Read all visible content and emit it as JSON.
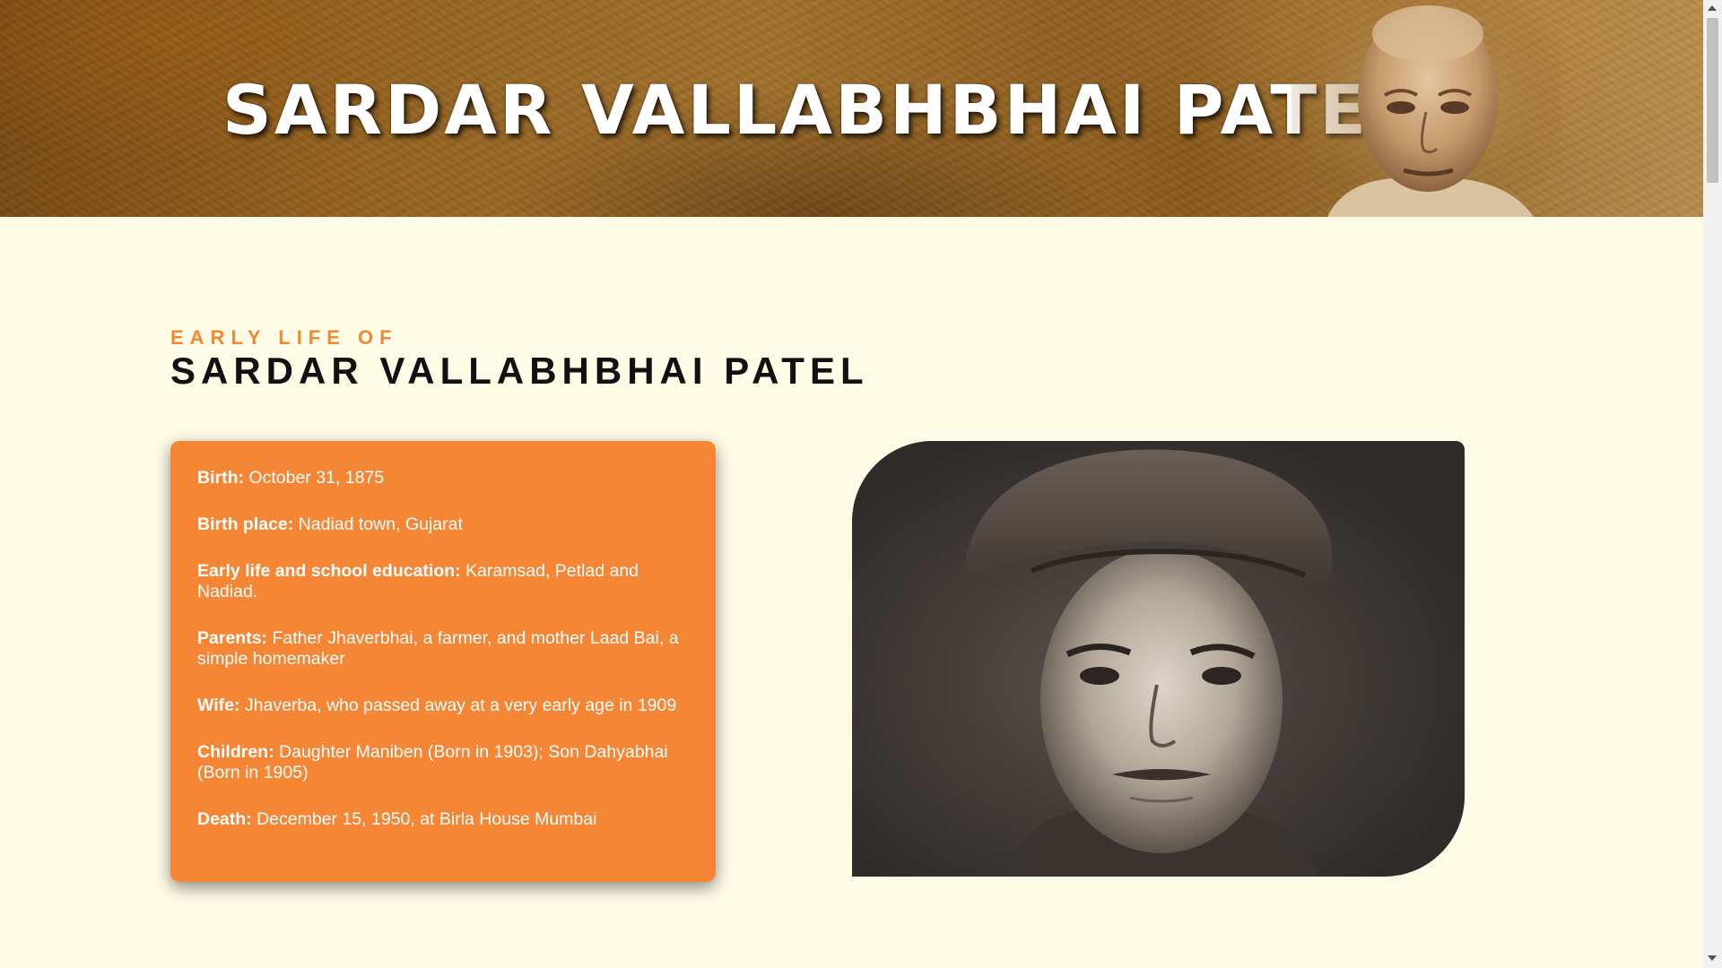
{
  "banner": {
    "title": "SARDAR VALLABHBHAI PATEL"
  },
  "section": {
    "eyebrow": "EARLY LIFE OF",
    "title": "SARDAR VALLABHBHAI PATEL"
  },
  "facts": [
    {
      "label": "Birth:",
      "value": "October 31, 1875"
    },
    {
      "label": "Birth place:",
      "value": "Nadiad town, Gujarat"
    },
    {
      "label": "Early life and school education:",
      "value": "Karamsad, Petlad and Nadiad."
    },
    {
      "label": "Parents:",
      "value": "Father Jhaverbhai, a farmer, and mother Laad Bai, a simple homemaker"
    },
    {
      "label": "Wife:",
      "value": "Jhaverba, who passed away at a very early age in 1909"
    },
    {
      "label": "Children:",
      "value": "Daughter Maniben (Born in 1903); Son Dahyabhai (Born in 1905)"
    },
    {
      "label": "Death:",
      "value": "December 15, 1950, at Birla House Mumbai"
    }
  ],
  "colors": {
    "background": "#fefbe6",
    "accent": "#f28a35",
    "card": "#f48635",
    "photo_bg": "#3d3a39"
  }
}
